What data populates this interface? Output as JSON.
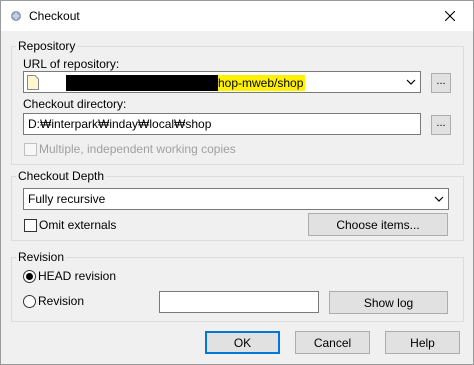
{
  "window": {
    "title": "Checkout"
  },
  "repository": {
    "group_label": "Repository",
    "url_label": "URL of repository:",
    "url_value_visible": "hop-mweb/shop",
    "browse_url_label": "...",
    "dir_label": "Checkout directory:",
    "dir_value": "D:₩interpark₩inday₩local₩shop",
    "browse_dir_label": "...",
    "multiple_copies_label": "Multiple, independent working copies",
    "multiple_copies_checked": false
  },
  "depth": {
    "group_label": "Checkout Depth",
    "selected": "Fully recursive",
    "omit_externals_label": "Omit externals",
    "omit_externals_checked": false,
    "choose_items_label": "Choose items..."
  },
  "revision": {
    "group_label": "Revision",
    "head_label": "HEAD revision",
    "head_checked": true,
    "revision_label": "Revision",
    "revision_value": "",
    "show_log_label": "Show log"
  },
  "footer": {
    "ok_label": "OK",
    "cancel_label": "Cancel",
    "help_label": "Help"
  },
  "icons": [
    "app-icon",
    "close-icon",
    "file-icon",
    "chevron-down-icon"
  ]
}
